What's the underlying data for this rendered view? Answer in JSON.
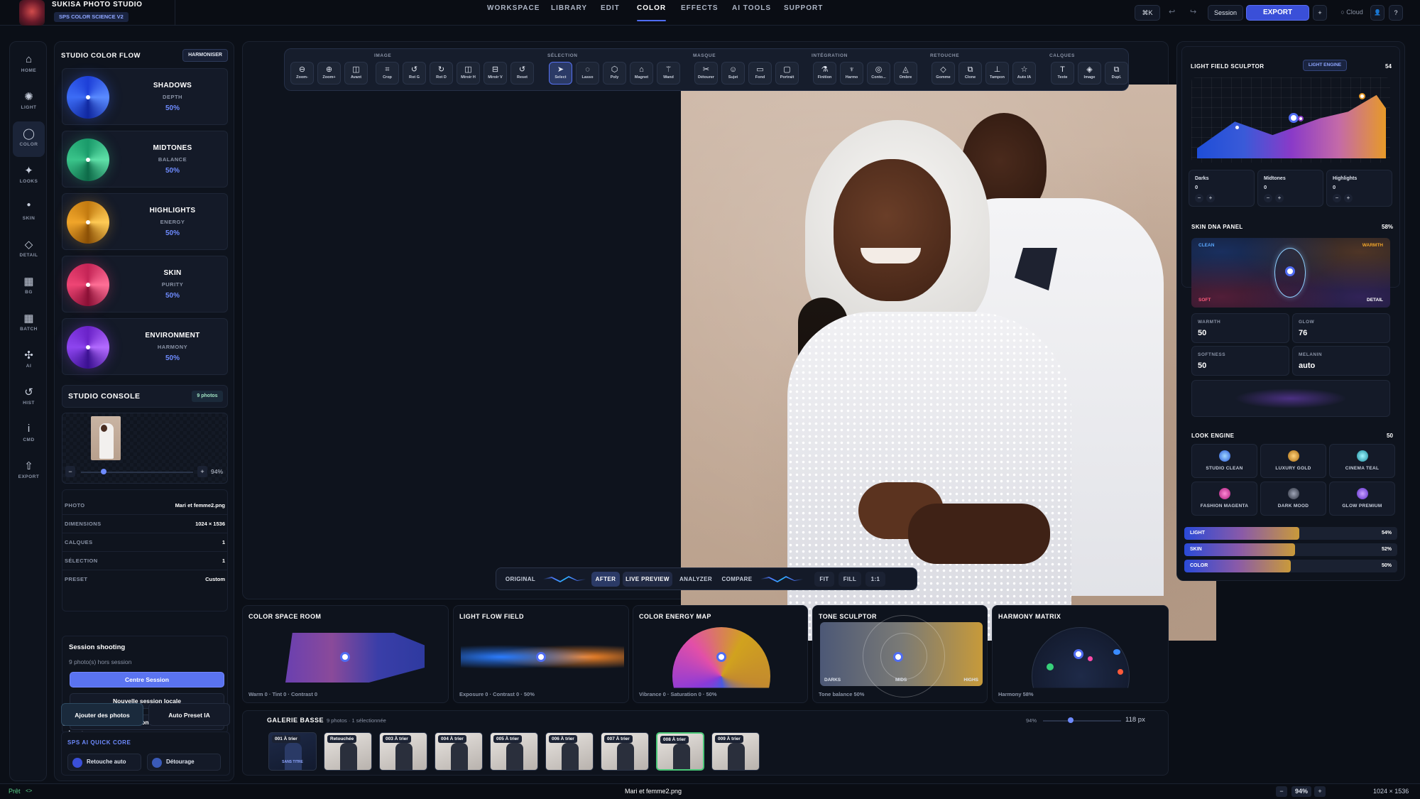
{
  "app": {
    "title": "SUKISA PHOTO STUDIO",
    "subtitle": "SPS COLOR SCIENCE V2"
  },
  "nav": [
    "WORKSPACE",
    "LIBRARY",
    "EDIT",
    "COLOR",
    "EFFECTS",
    "AI TOOLS",
    "SUPPORT"
  ],
  "nav_active": "COLOR",
  "top_right": {
    "shortcut": "⌘K",
    "undo": "↩",
    "redo": "↪",
    "session": "Session",
    "export": "EXPORT",
    "plus": "+",
    "cloud": "○ Cloud",
    "user": "👤",
    "help": "?"
  },
  "rail": [
    {
      "label": "HOME",
      "icon": "⌂"
    },
    {
      "label": "LIGHT",
      "icon": "✺"
    },
    {
      "label": "COLOR",
      "icon": "◯"
    },
    {
      "label": "LOOKS",
      "icon": "✦"
    },
    {
      "label": "SKIN",
      "icon": "●"
    },
    {
      "label": "DETAIL",
      "icon": "◇"
    },
    {
      "label": "BG",
      "icon": "▦"
    },
    {
      "label": "BATCH",
      "icon": "▦"
    },
    {
      "label": "AI",
      "icon": "✣"
    },
    {
      "label": "HIST",
      "icon": "↺"
    },
    {
      "label": "CMD",
      "icon": "i"
    },
    {
      "label": "EXPORT",
      "icon": "⇧"
    }
  ],
  "flow": {
    "title": "STUDIO COLOR FLOW",
    "badge": "HARMONISER",
    "items": [
      {
        "name": "SHADOWS",
        "sub": "DEPTH",
        "value": "50%"
      },
      {
        "name": "MIDTONES",
        "sub": "BALANCE",
        "value": "50%"
      },
      {
        "name": "HIGHLIGHTS",
        "sub": "ENERGY",
        "value": "50%"
      },
      {
        "name": "SKIN",
        "sub": "PURITY",
        "value": "50%"
      },
      {
        "name": "ENVIRONMENT",
        "sub": "HARMONY",
        "value": "50%"
      }
    ]
  },
  "console": {
    "title": "STUDIO CONSOLE",
    "badge": "9 photos",
    "zoom": "94%",
    "zoom_fraction": 0.2,
    "minus": "−",
    "plus": "+",
    "meta": [
      {
        "k": "PHOTO",
        "v": "Mari et femme2.png"
      },
      {
        "k": "DIMENSIONS",
        "v": "1024 × 1536"
      },
      {
        "k": "CALQUES",
        "v": "1"
      },
      {
        "k": "SÉLECTION",
        "v": "1"
      },
      {
        "k": "PRESET",
        "v": "Custom"
      }
    ]
  },
  "session": {
    "title": "Session shooting",
    "info": "9 photo(s) hors session",
    "center": "Centre Session",
    "new_local": "Nouvelle session locale",
    "open_saved": "Ouvrir session sauvegardée",
    "add_photos": "Ajouter des photos",
    "auto_preset": "Auto Preset IA"
  },
  "quick": {
    "title": "SPS AI QUICK CORE",
    "a": "Retouche auto",
    "b": "Détourage"
  },
  "toolbar": {
    "groups": [
      "IMAGE",
      "SÉLECTION",
      "MASQUE",
      "INTÉGRATION",
      "RETOUCHE",
      "CALQUES"
    ],
    "tools": [
      {
        "label": "Zoom-",
        "icon": "⊖"
      },
      {
        "label": "Zoom+",
        "icon": "⊕"
      },
      {
        "label": "Avant",
        "icon": "◫"
      },
      {
        "label": "Crop",
        "icon": "⌗"
      },
      {
        "label": "Rot G",
        "icon": "↺"
      },
      {
        "label": "Rot D",
        "icon": "↻"
      },
      {
        "label": "Miroir H",
        "icon": "◫"
      },
      {
        "label": "Miroir V",
        "icon": "⊟"
      },
      {
        "label": "Reset",
        "icon": "↺"
      },
      {
        "label": "Select",
        "icon": "➤"
      },
      {
        "label": "Lasso",
        "icon": "◌"
      },
      {
        "label": "Poly",
        "icon": "⬡"
      },
      {
        "label": "Magnet",
        "icon": "⌂"
      },
      {
        "label": "Wand",
        "icon": "⚚"
      },
      {
        "label": "Détourer",
        "icon": "✂"
      },
      {
        "label": "Sujet",
        "icon": "☺"
      },
      {
        "label": "Fond",
        "icon": "▭"
      },
      {
        "label": "Portrait",
        "icon": "▢"
      },
      {
        "label": "Finition",
        "icon": "⚗"
      },
      {
        "label": "Harmo",
        "icon": "♆"
      },
      {
        "label": "Conto...",
        "icon": "◎"
      },
      {
        "label": "Ombre",
        "icon": "◬"
      },
      {
        "label": "Gomme",
        "icon": "◇"
      },
      {
        "label": "Clone",
        "icon": "⧉"
      },
      {
        "label": "Tampon",
        "icon": "⊥"
      },
      {
        "label": "Auto IA",
        "icon": "☆"
      },
      {
        "label": "Texte",
        "icon": "T"
      },
      {
        "label": "Image",
        "icon": "◈"
      },
      {
        "label": "Dupl.",
        "icon": "⧉"
      }
    ]
  },
  "viewbar": {
    "original": "ORIGINAL",
    "after": "AFTER",
    "live": "LIVE PREVIEW",
    "analyzer": "ANALYZER",
    "compare": "COMPARE",
    "fit": "FIT",
    "fill": "FILL",
    "one": "1:1"
  },
  "maps": [
    {
      "title": "COLOR SPACE ROOM",
      "foot": "Warm 0 · Tint 0 · Contrast 0"
    },
    {
      "title": "LIGHT FLOW FIELD",
      "foot": "Exposure 0 · Contrast 0 · 50%"
    },
    {
      "title": "COLOR ENERGY MAP",
      "foot": "Vibrance 0 · Saturation 0 · 50%"
    },
    {
      "title": "TONE SCULPTOR",
      "foot": "Tone balance 50%",
      "l1": "DARKS",
      "l2": "MIDS",
      "l3": "HIGHS"
    },
    {
      "title": "HARMONY MATRIX",
      "foot": "Harmony 58%"
    }
  ],
  "gallery": {
    "title": "GALERIE BASSE",
    "info": "9 photos · 1 sélectionnée",
    "zoom": "94%",
    "size": "118 px",
    "size_fraction": 0.35,
    "first_caption": "SANS TITRE",
    "items": [
      "001  À trier",
      "Retouchée",
      "003  À trier",
      "004  À trier",
      "005  À trier",
      "006  À trier",
      "007  À trier",
      "008  À trier",
      "009  À trier"
    ]
  },
  "right": {
    "lfs": {
      "title": "LIGHT FIELD SCULPTOR",
      "badge": "LIGHT ENGINE",
      "num": "54",
      "darks": "Darks",
      "mids": "Midtones",
      "highs": "Highlights",
      "dv": "0",
      "mv": "0",
      "hv": "0",
      "minus": "−",
      "plus": "+"
    },
    "skin": {
      "title": "SKIN DNA PANEL",
      "pct": "58%",
      "clean": "CLEAN",
      "warmth": "WARMTH",
      "soft": "SOFT",
      "detail": "DETAIL",
      "stats": [
        {
          "k": "WARMTH",
          "v": "50"
        },
        {
          "k": "GLOW",
          "v": "76"
        },
        {
          "k": "SOFTNESS",
          "v": "50"
        },
        {
          "k": "MELANIN",
          "v": "auto"
        }
      ]
    },
    "look": {
      "title": "LOOK ENGINE",
      "num": "50",
      "items": [
        "STUDIO CLEAN",
        "LUXURY GOLD",
        "CINEMA TEAL",
        "FASHION MAGENTA",
        "DARK MOOD",
        "GLOW PREMIUM"
      ]
    },
    "bars": [
      {
        "k": "LIGHT",
        "v": "54%",
        "f": 0.54
      },
      {
        "k": "SKIN",
        "v": "52%",
        "f": 0.52
      },
      {
        "k": "COLOR",
        "v": "50%",
        "f": 0.5
      }
    ]
  },
  "status": {
    "left": "Prêt",
    "code": "<>",
    "file": "Mari et femme2.png",
    "minus": "−",
    "zoom": "94%",
    "plus": "+",
    "dims": "1024 × 1536"
  }
}
